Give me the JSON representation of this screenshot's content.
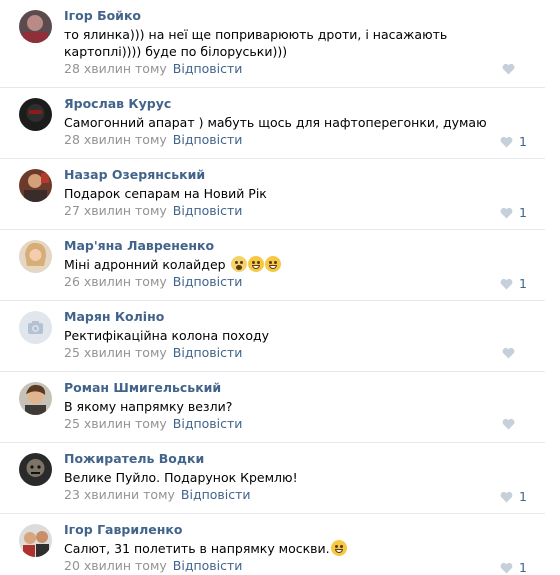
{
  "reply_label": "Відповісти",
  "heart_icon": "heart-icon",
  "colors": {
    "author": "#42648b",
    "meta": "#939393",
    "reply": "#42648b",
    "divider": "#e7e8ec"
  },
  "comments": [
    {
      "author": "Ігор Бойко",
      "text": "то ялинка))) на неї ще поприварюють дроти, і насажають картоплі)))) буде по білоруськи)))",
      "time": "28 хвилин тому",
      "likes": ""
    },
    {
      "author": "Ярослав Курус",
      "text": "Самогонний апарат ) мабуть щось для нафтоперегонки, думаю",
      "time": "28 хвилин тому",
      "likes": "1"
    },
    {
      "author": "Назар Озерянський",
      "text": "Подарок сепарам на Новий Рік",
      "time": "27 хвилин тому",
      "likes": "1"
    },
    {
      "author": "Мар'яна Лаврененко",
      "text": "Міні адронний колайдер",
      "time": "26 хвилин тому",
      "likes": "1"
    },
    {
      "author": "Марян Коліно",
      "text": "Ректифікаційна колона походу",
      "time": "25 хвилин тому",
      "likes": ""
    },
    {
      "author": "Роман Шмигельський",
      "text": "В якому напрямку везли?",
      "time": "25 хвилин тому",
      "likes": ""
    },
    {
      "author": "Пожиратель Водки",
      "text": "Велике Пуйло. Подарунок Кремлю!",
      "time": "23 хвилини тому",
      "likes": "1"
    },
    {
      "author": "Ігор Гавриленко",
      "text": "Салют, 31 полетить в напрямку москви.",
      "time": "20 хвилин тому",
      "likes": "1"
    }
  ]
}
